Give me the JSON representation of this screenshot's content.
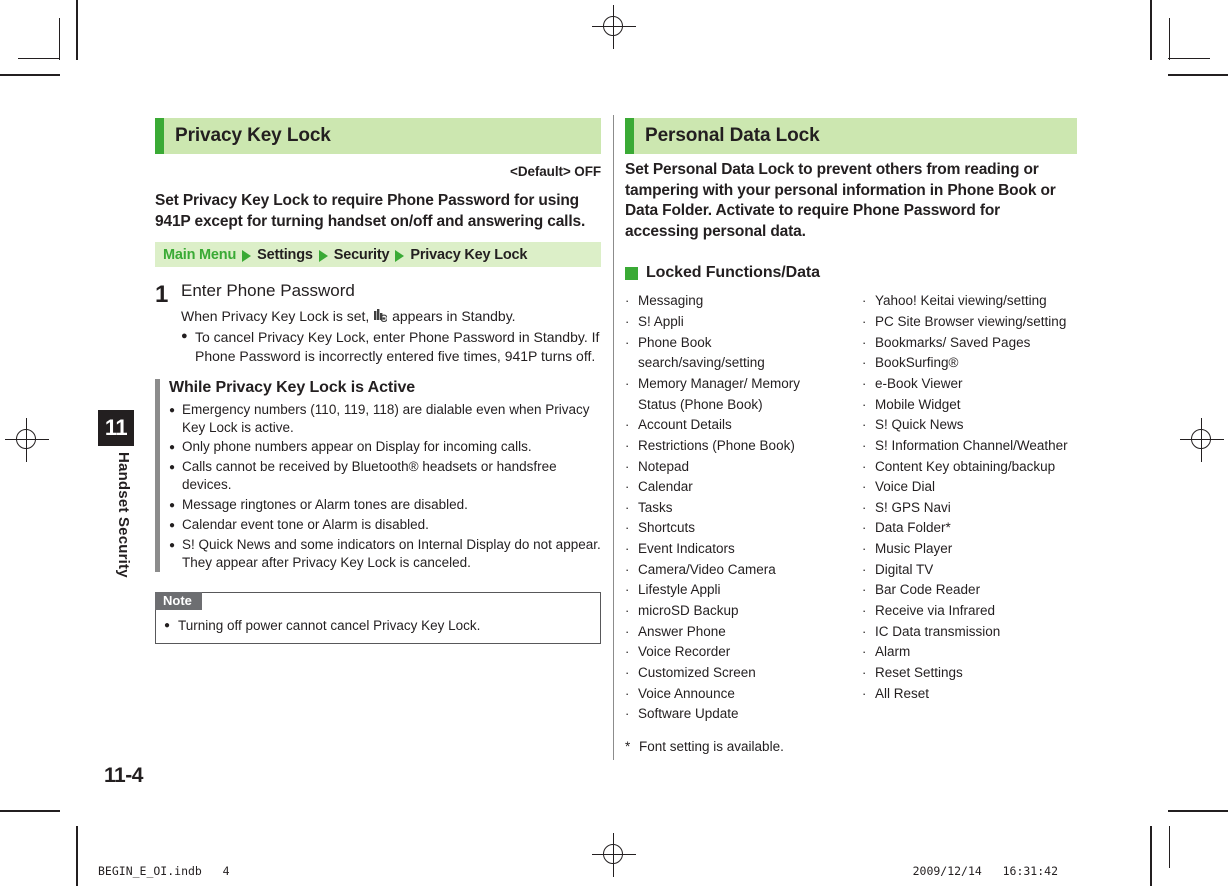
{
  "sidebar": {
    "chapter_number": "11",
    "chapter_title": "Handset Security",
    "page_number": "11-4"
  },
  "left_column": {
    "section_title": "Privacy Key Lock",
    "default_line": "<Default> OFF",
    "lead": "Set Privacy Key Lock to require Phone Password for using 941P except for turning handset on/off and answering calls.",
    "breadcrumb": {
      "items": [
        "Main Menu",
        "Settings",
        "Security",
        "Privacy Key Lock"
      ],
      "arrow_icon": "triangle-right-icon"
    },
    "step": {
      "number": "1",
      "title": "Enter Phone Password",
      "note_before_icon": "When Privacy Key Lock is set,",
      "icon_name": "privacy-key-lock-standby-icon",
      "note_after_icon": "appears in Standby.",
      "bullets": [
        "To cancel Privacy Key Lock, enter Phone Password in Standby. If Phone Password is incorrectly entered five times, 941P turns off."
      ]
    },
    "subsection": {
      "title": "While Privacy Key Lock is Active",
      "items": [
        "Emergency numbers (110, 119, 118) are dialable even when Privacy Key Lock is active.",
        "Only phone numbers appear on Display for incoming calls.",
        "Calls cannot be received by Bluetooth® headsets or handsfree devices.",
        "Message ringtones or Alarm tones are disabled.",
        "Calendar event tone or Alarm is disabled.",
        "S! Quick News and some indicators on Internal Display do not appear. They appear after Privacy Key Lock is canceled."
      ]
    },
    "note": {
      "tag": "Note",
      "items": [
        "Turning off power cannot cancel Privacy Key Lock."
      ]
    }
  },
  "right_column": {
    "section_title": "Personal Data Lock",
    "lead": "Set Personal Data Lock to prevent others from reading or tampering with your personal information in Phone Book or Data Folder. Activate to require Phone Password for accessing personal data.",
    "locked_heading": "Locked Functions/Data",
    "locked_list_left": [
      "Messaging",
      "S! Appli",
      "Phone Book search/saving/setting",
      "Memory Manager/ Memory Status (Phone Book)",
      "Account Details",
      "Restrictions (Phone Book)",
      "Notepad",
      "Calendar",
      "Tasks",
      "Shortcuts",
      "Event Indicators",
      "Camera/Video Camera",
      "Lifestyle Appli",
      "microSD Backup",
      "Answer Phone",
      "Voice Recorder",
      "Customized Screen",
      "Voice Announce",
      "Software Update"
    ],
    "locked_list_right": [
      "Yahoo! Keitai viewing/setting",
      "PC Site Browser viewing/setting",
      "Bookmarks/ Saved Pages",
      "BookSurfing®",
      "e-Book Viewer",
      "Mobile Widget",
      "S! Quick News",
      "S! Information Channel/Weather",
      "Content Key obtaining/backup",
      "Voice Dial",
      "S! GPS Navi",
      "Data Folder*",
      "Music Player",
      "Digital TV",
      "Bar Code Reader",
      "Receive via Infrared",
      "IC Data transmission",
      "Alarm",
      "Reset Settings",
      "All Reset"
    ],
    "footnote_marker": "*",
    "footnote": "Font setting is available."
  },
  "print_footer": {
    "left": "BEGIN_E_OI.indb   4",
    "right": "2009/12/14   16:31:42"
  },
  "colors": {
    "accent_green": "#3aaa35",
    "header_bg": "#cce7b0",
    "breadcrumb_bg": "#dcefc8",
    "text": "#231f20",
    "note_tag_bg": "#6d6e71",
    "rule_gray": "#8c8c8c"
  }
}
